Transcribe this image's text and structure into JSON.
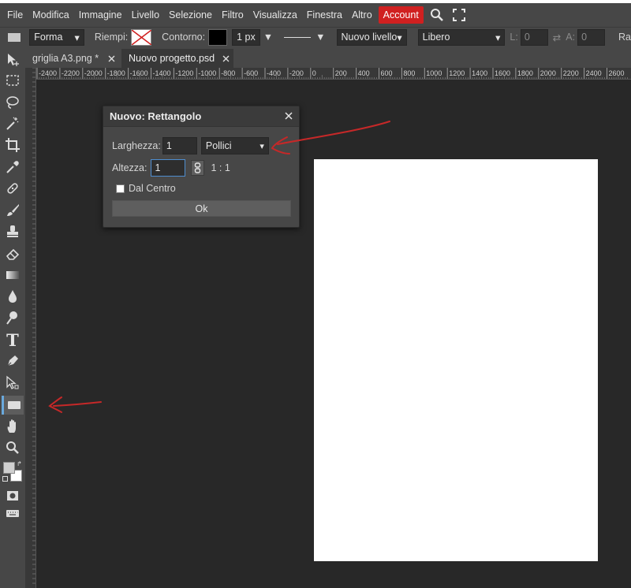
{
  "menubar": {
    "items": [
      "File",
      "Modifica",
      "Immagine",
      "Livello",
      "Selezione",
      "Filtro",
      "Visualizza",
      "Finestra",
      "Altro"
    ],
    "account": "Account",
    "icons": [
      "search-icon",
      "fullscreen-icon"
    ],
    "account_color": "#d02020"
  },
  "options": {
    "mode": "Forma",
    "fill_label": "Riempi:",
    "stroke_label": "Contorno:",
    "stroke_width": "1 px",
    "layer": "Nuovo livello",
    "constraint": "Libero",
    "l_label": "L:",
    "l_value": "0",
    "a_label": "A:",
    "a_value": "0",
    "truncated_label": "Ra"
  },
  "tabs": [
    {
      "label": "griglia A3.png *",
      "active": false
    },
    {
      "label": "Nuovo progetto.psd",
      "active": true
    }
  ],
  "ruler": {
    "top_labels": [
      "-2400",
      "-2200",
      "-2000",
      "-1800",
      "-1600",
      "-1400",
      "-1200",
      "-1000",
      "-800",
      "-600",
      "-400",
      "-200",
      "0",
      "200",
      "400",
      "600",
      "800",
      "1000",
      "1200",
      "1400",
      "1600",
      "1800",
      "2000",
      "2200",
      "2400",
      "2600"
    ]
  },
  "dialog": {
    "title": "Nuovo: Rettangolo",
    "width_label": "Larghezza:",
    "width_value": "1",
    "unit": "Pollici",
    "height_label": "Altezza:",
    "height_value": "1",
    "ratio": "1 : 1",
    "center_label": "Dal Centro",
    "center_checked": false,
    "ok": "Ok"
  },
  "colors": {
    "ui": "#474747",
    "workspace": "#282828",
    "accent": "#4f8ed0",
    "annotation": "#c62828"
  }
}
